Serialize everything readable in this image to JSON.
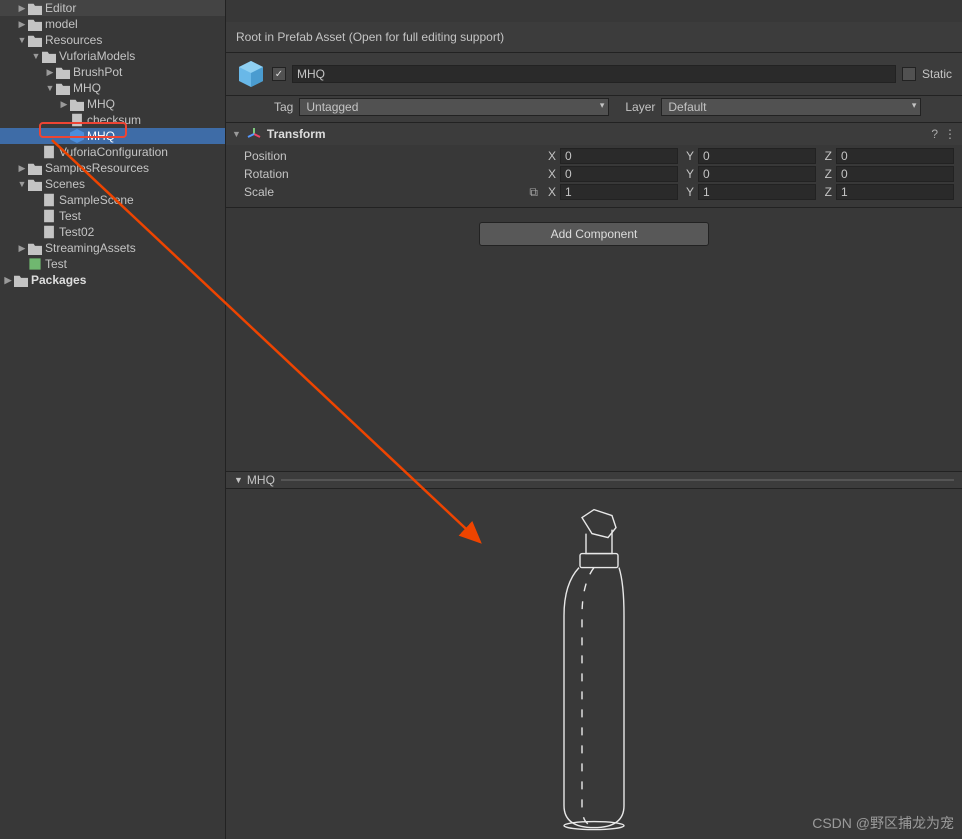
{
  "tree": {
    "editor": "Editor",
    "model": "model",
    "resources": "Resources",
    "vuforiaModels": "VuforiaModels",
    "brushpot": "BrushPot",
    "mhq_folder": "MHQ",
    "mhq_sub": "MHQ",
    "checksum": "checksum",
    "mhq_prefab": "MHQ",
    "vuforiaConfig": "VuforiaConfiguration",
    "samplesResources": "SamplesResources",
    "scenes": "Scenes",
    "sampleScene": "SampleScene",
    "test": "Test",
    "test02": "Test02",
    "streamingAssets": "StreamingAssets",
    "test_asset": "Test",
    "packages": "Packages"
  },
  "inspector": {
    "prefab_banner": "Root in Prefab Asset (Open for full editing support)",
    "name_value": "MHQ",
    "static_label": "Static",
    "tag_label": "Tag",
    "tag_value": "Untagged",
    "layer_label": "Layer",
    "layer_value": "Default",
    "transform_title": "Transform",
    "position_label": "Position",
    "rotation_label": "Rotation",
    "scale_label": "Scale",
    "x": "X",
    "y": "Y",
    "z": "Z",
    "position": {
      "x": "0",
      "y": "0",
      "z": "0"
    },
    "rotation": {
      "x": "0",
      "y": "0",
      "z": "0"
    },
    "scale": {
      "x": "1",
      "y": "1",
      "z": "1"
    },
    "add_component": "Add Component",
    "preview_title": "MHQ"
  },
  "watermark": "CSDN @野区捕龙为宠",
  "checkmark": "✓",
  "help": "?",
  "menu": "⋮"
}
